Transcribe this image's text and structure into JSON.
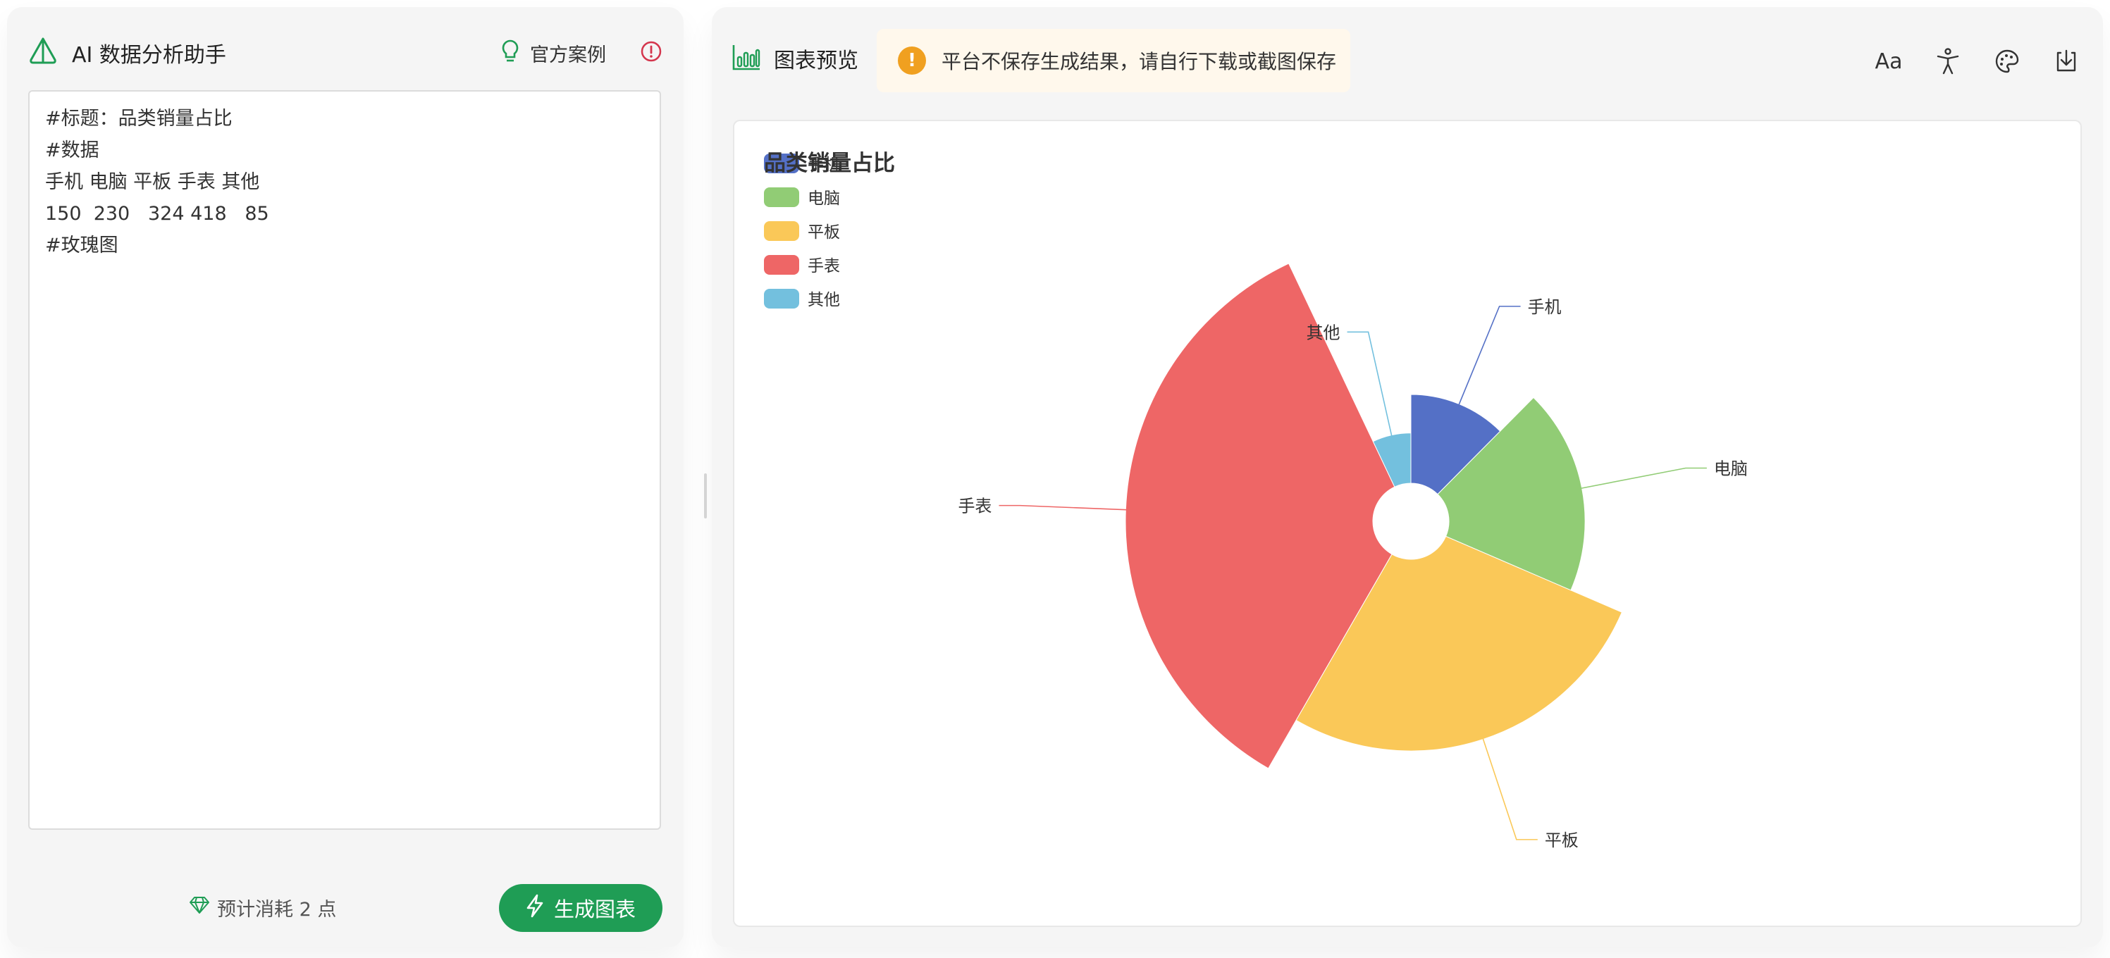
{
  "left": {
    "title": "AI 数据分析助手",
    "cases_label": "官方案例",
    "editor_lines": [
      "#标题：品类销量占比",
      "#数据",
      "手机 电脑 平板 手表 其他",
      "150  230   324 418   85",
      "#玫瑰图"
    ],
    "cost_text": "预计消耗 2 点",
    "generate_label": "生成图表",
    "accent": "#1f9d55"
  },
  "right": {
    "title": "图表预览",
    "notice": "平台不保存生成结果，请自行下载或截图保存",
    "font_tool_label": "Aa",
    "icons": [
      "font-icon",
      "accessibility-icon",
      "palette-icon",
      "download-icon"
    ]
  },
  "chart_data": {
    "type": "pie",
    "variant": "rose",
    "title": "品类销量占比",
    "categories": [
      "手机",
      "电脑",
      "平板",
      "手表",
      "其他"
    ],
    "values": [
      150,
      230,
      324,
      418,
      85
    ],
    "colors": [
      "#5470c6",
      "#91cc75",
      "#fac858",
      "#ee6666",
      "#73c0de"
    ],
    "legend_position": "top-left"
  }
}
